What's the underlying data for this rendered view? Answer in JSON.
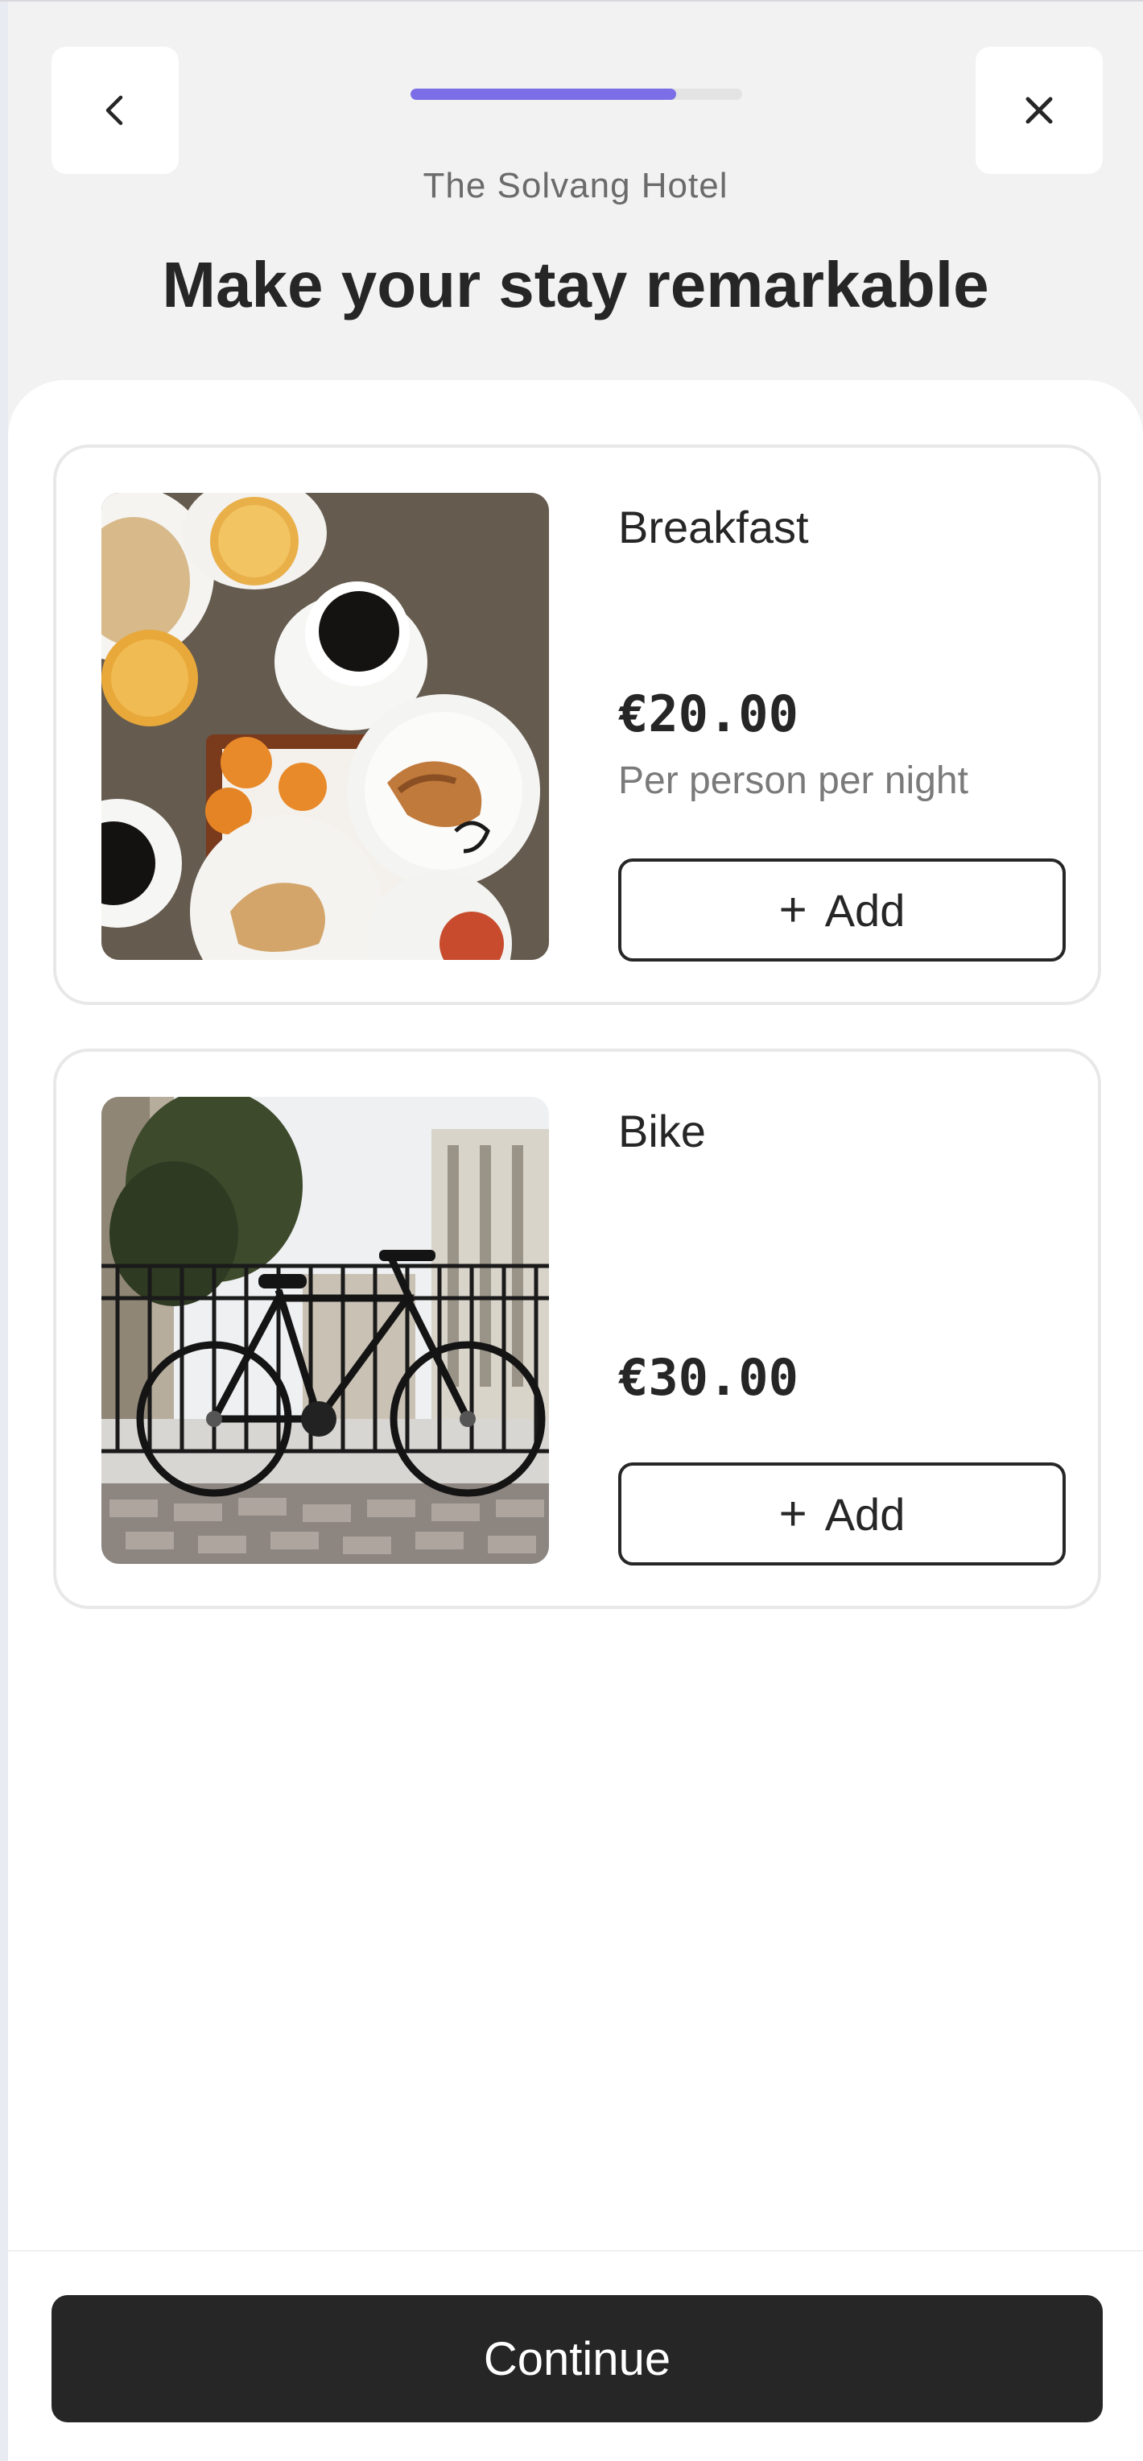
{
  "header": {
    "back_icon": "chevron-left-icon",
    "close_icon": "close-icon",
    "progress": 0.8,
    "hotel_name": "The Solvang Hotel",
    "title": "Make your stay remarkable"
  },
  "extras": [
    {
      "name": "Breakfast",
      "price": "€20.00",
      "unit": "Per person per night",
      "add_label": "Add",
      "add_icon": "plus-icon"
    },
    {
      "name": "Bike",
      "price": "€30.00",
      "add_label": "Add",
      "add_icon": "plus-icon"
    }
  ],
  "footer": {
    "continue_label": "Continue"
  },
  "colors": {
    "accent": "#7b6ee6",
    "button_dark": "#262626",
    "background": "#f2f2f2"
  }
}
